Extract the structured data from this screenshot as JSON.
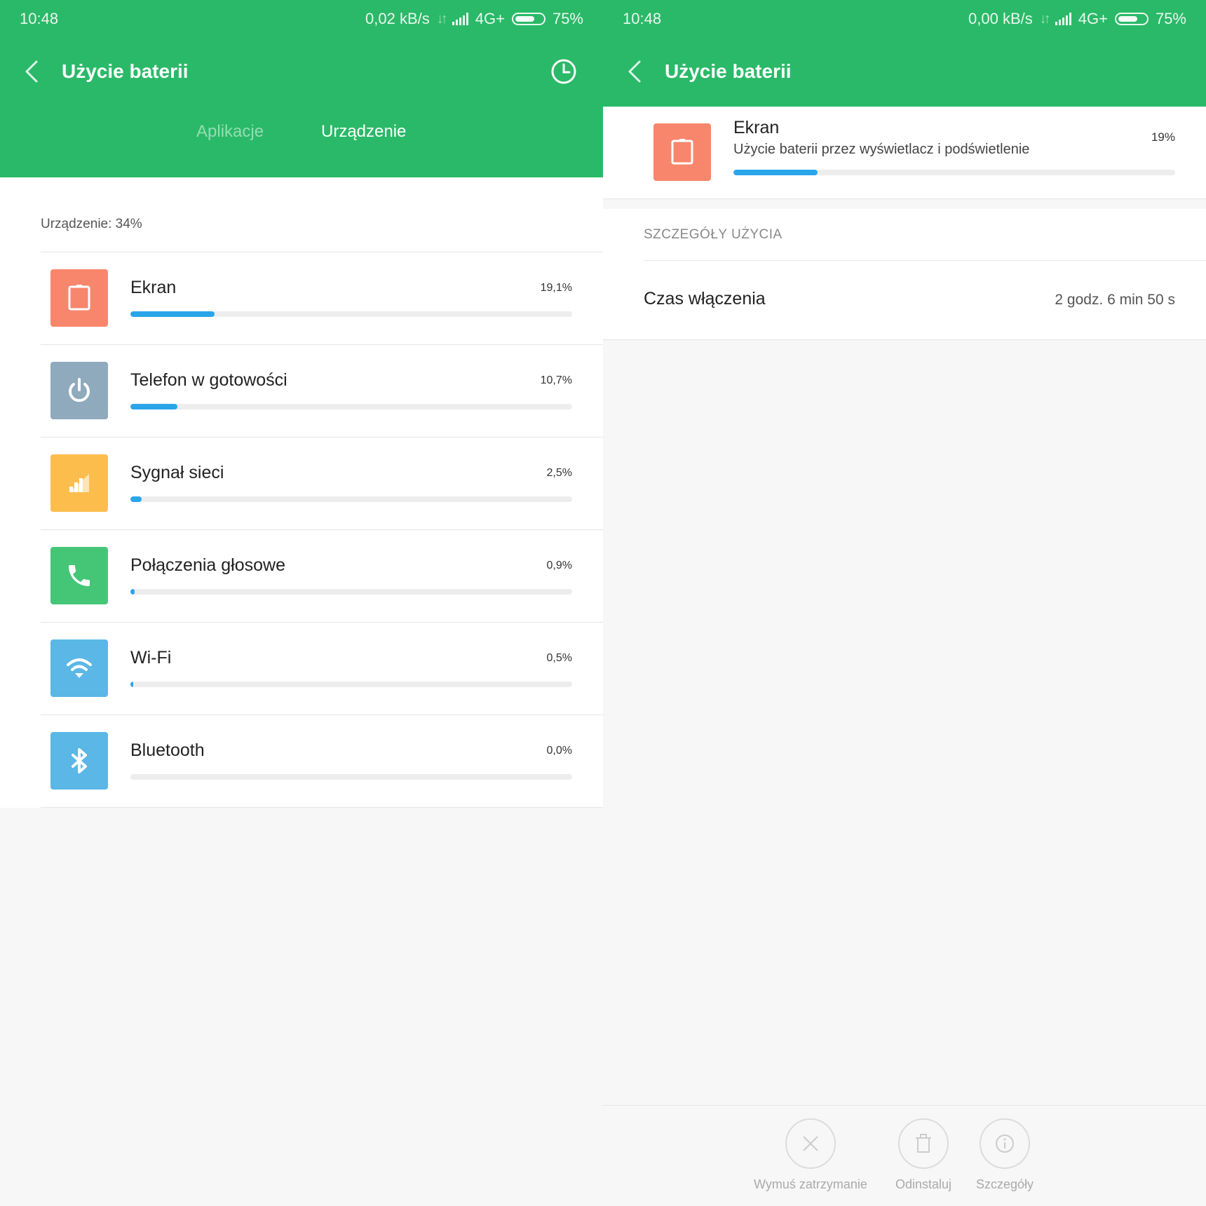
{
  "left": {
    "status": {
      "time": "10:48",
      "speed": "0,02 kB/s",
      "network": "4G+",
      "battery_level": 75,
      "battery_text": "75%"
    },
    "header": {
      "title": "Użycie baterii"
    },
    "tabs": [
      {
        "label": "Aplikacje",
        "active": false
      },
      {
        "label": "Urządzenie",
        "active": true
      }
    ],
    "summary": "Urządzenie: 34%",
    "items": [
      {
        "name": "Ekran",
        "percent": "19,1%",
        "value": 19.1,
        "color": "#f8866c",
        "icon": "tablet-icon"
      },
      {
        "name": "Telefon w gotowości",
        "percent": "10,7%",
        "value": 10.7,
        "color": "#8fa9bd",
        "icon": "power-icon"
      },
      {
        "name": "Sygnał sieci",
        "percent": "2,5%",
        "value": 2.5,
        "color": "#fdbd4d",
        "icon": "signal-icon"
      },
      {
        "name": "Połączenia głosowe",
        "percent": "0,9%",
        "value": 0.9,
        "color": "#45c677",
        "icon": "phone-icon"
      },
      {
        "name": "Wi-Fi",
        "percent": "0,5%",
        "value": 0.5,
        "color": "#5ab7e6",
        "icon": "wifi-icon"
      },
      {
        "name": "Bluetooth",
        "percent": "0,0%",
        "value": 0.0,
        "color": "#5ab7e6",
        "icon": "bluetooth-icon"
      }
    ]
  },
  "right": {
    "status": {
      "time": "10:48",
      "speed": "0,00 kB/s",
      "network": "4G+",
      "battery_level": 75,
      "battery_text": "75%"
    },
    "header": {
      "title": "Użycie baterii"
    },
    "detail": {
      "name": "Ekran",
      "description": "Użycie baterii przez wyświetlacz i podświetlenie",
      "percent": "19%",
      "value": 19
    },
    "usage": {
      "section_title": "SZCZEGÓŁY UŻYCIA",
      "row_label": "Czas włączenia",
      "row_value": "2 godz. 6 min 50 s"
    },
    "actions": {
      "force_stop": "Wymuś zatrzymanie",
      "uninstall": "Odinstaluj",
      "details": "Szczegóły"
    }
  }
}
